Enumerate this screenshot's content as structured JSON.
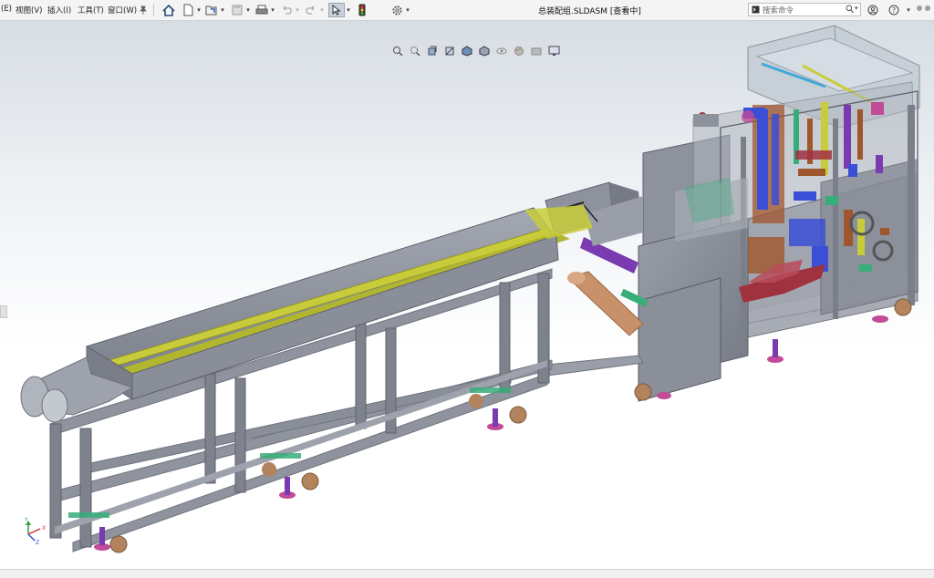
{
  "menu": {
    "items": [
      {
        "label": "(E)"
      },
      {
        "label": "视图(V)"
      },
      {
        "label": "插入(I)"
      },
      {
        "label": "工具(T)"
      },
      {
        "label": "窗口(W)"
      }
    ]
  },
  "toolbar": {
    "icons": [
      "pin-icon",
      "home-icon",
      "new-document-icon",
      "open-folder-icon",
      "save-icon",
      "print-icon",
      "undo-icon",
      "redo-icon",
      "select-arrow-icon",
      "traffic-light-icon",
      "options-gear-icon"
    ]
  },
  "document": {
    "title": "总装配组.SLDASM [查看中]"
  },
  "search": {
    "placeholder": "搜索命令"
  },
  "help_icons": [
    "user-icon",
    "help-icon"
  ],
  "heads_up_view": {
    "icons": [
      "zoom-to-fit-icon",
      "zoom-to-area-icon",
      "previous-view-icon",
      "section-view-icon",
      "view-orientation-icon",
      "display-style-icon",
      "hide-show-icon",
      "edit-appearance-icon",
      "apply-scene-icon",
      "view-settings-icon"
    ]
  },
  "viewport": {
    "model": "assembly-3d-model",
    "triad": {
      "x": "X",
      "y": "Y",
      "z": "Z"
    }
  },
  "colors": {
    "frame": "#8f939e",
    "frame_dark": "#6f737d",
    "rail_yellow": "#c8cc3a",
    "copper": "#c9916a",
    "wheel": "#b2835c",
    "foot": "#c24a98",
    "purple": "#7a3bb0",
    "blue": "#3b4fd6",
    "red_part": "#a0313f",
    "green_plate": "#37ad7a",
    "glass": "#b8c2cc"
  }
}
